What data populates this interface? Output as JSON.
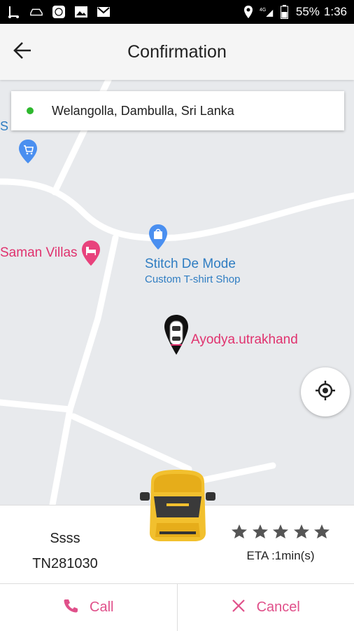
{
  "status_bar": {
    "battery": "55%",
    "time": "1:36",
    "network": "4G",
    "icons": [
      "scooter-icon",
      "car-icon",
      "app-icon",
      "image-icon",
      "gmail-icon",
      "location-icon",
      "signal-icon",
      "battery-icon"
    ]
  },
  "app_bar": {
    "title": "Confirmation",
    "back_icon": "arrow-back-icon"
  },
  "search": {
    "location": "Welangolla, Dambulla, Sri Lanka"
  },
  "map": {
    "pois": [
      {
        "name": "Saman Villas",
        "category": "hotel",
        "color": "#e0326e"
      },
      {
        "name": "Stitch De Mode",
        "subtitle": "Custom T-shirt Shop",
        "category": "shopping",
        "color": "#2f7dc2"
      },
      {
        "name": "S",
        "category": "shopping",
        "color": "#2f7dc2"
      }
    ],
    "driver_label": "Ayodya.utrakhand"
  },
  "driver": {
    "name": "Ssss",
    "vehicle_no": "TN281030",
    "rating_stars": 5,
    "eta": "ETA :1min(s)"
  },
  "actions": {
    "call_label": "Call",
    "cancel_label": "Cancel"
  },
  "colors": {
    "accent": "#e0508a",
    "status_dot": "#2eb82e",
    "poi_pink": "#e0326e",
    "poi_blue": "#2f7dc2"
  }
}
